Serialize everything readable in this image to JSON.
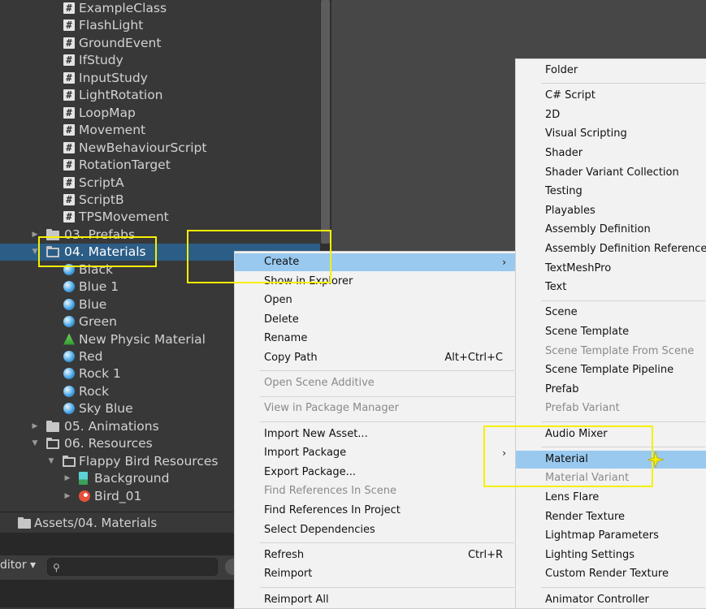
{
  "project": {
    "tree": [
      {
        "indent": 1,
        "icon": "hash",
        "label": "ExampleClass"
      },
      {
        "indent": 1,
        "icon": "hash",
        "label": "FlashLight"
      },
      {
        "indent": 1,
        "icon": "hash",
        "label": "GroundEvent"
      },
      {
        "indent": 1,
        "icon": "hash",
        "label": "IfStudy"
      },
      {
        "indent": 1,
        "icon": "hash",
        "label": "InputStudy"
      },
      {
        "indent": 1,
        "icon": "hash",
        "label": "LightRotation"
      },
      {
        "indent": 1,
        "icon": "hash",
        "label": "LoopMap"
      },
      {
        "indent": 1,
        "icon": "hash",
        "label": "Movement"
      },
      {
        "indent": 1,
        "icon": "hash",
        "label": "NewBehaviourScript"
      },
      {
        "indent": 1,
        "icon": "hash",
        "label": "RotationTarget"
      },
      {
        "indent": 1,
        "icon": "hash",
        "label": "ScriptA"
      },
      {
        "indent": 1,
        "icon": "hash",
        "label": "ScriptB"
      },
      {
        "indent": 1,
        "icon": "hash",
        "label": "TPSMovement"
      },
      {
        "indent": 0,
        "icon": "folder",
        "arrow": "▶",
        "label": "03. Prefabs"
      },
      {
        "indent": 0,
        "icon": "folder-open",
        "arrow": "▼",
        "label": "04. Materials",
        "selected": true
      },
      {
        "indent": 1,
        "icon": "sphere",
        "label": "Black"
      },
      {
        "indent": 1,
        "icon": "sphere",
        "label": "Blue 1"
      },
      {
        "indent": 1,
        "icon": "sphere",
        "label": "Blue"
      },
      {
        "indent": 1,
        "icon": "sphere",
        "label": "Green"
      },
      {
        "indent": 1,
        "icon": "physic",
        "label": "New Physic Material"
      },
      {
        "indent": 1,
        "icon": "sphere",
        "label": "Red"
      },
      {
        "indent": 1,
        "icon": "sphere",
        "label": "Rock 1"
      },
      {
        "indent": 1,
        "icon": "sphere",
        "label": "Rock"
      },
      {
        "indent": 1,
        "icon": "sphere",
        "label": "Sky Blue"
      },
      {
        "indent": 0,
        "icon": "folder",
        "arrow": "▶",
        "label": "05. Animations"
      },
      {
        "indent": 0,
        "icon": "folder-open",
        "arrow": "▼",
        "label": "06. Resources"
      },
      {
        "indent": 1,
        "icon": "folder-open",
        "arrow": "▼",
        "label": "Flappy Bird Resources"
      },
      {
        "indent": 2,
        "icon": "bgsprite",
        "arrow": "▶",
        "label": "Background"
      },
      {
        "indent": 2,
        "icon": "bird",
        "arrow": "▶",
        "label": "Bird_01"
      }
    ],
    "breadcrumb": "Assets/04. Materials"
  },
  "toolbar": {
    "editor_label": "ditor ▾",
    "search_icon": "⚲"
  },
  "context_menu": {
    "items": [
      {
        "label": "Create",
        "submenu": true,
        "highlight": true
      },
      {
        "label": "Show in Explorer"
      },
      {
        "label": "Open"
      },
      {
        "label": "Delete"
      },
      {
        "label": "Rename"
      },
      {
        "label": "Copy Path",
        "shortcut": "Alt+Ctrl+C"
      },
      {
        "sep": true
      },
      {
        "label": "Open Scene Additive",
        "disabled": true
      },
      {
        "sep": true
      },
      {
        "label": "View in Package Manager",
        "disabled": true
      },
      {
        "sep": true
      },
      {
        "label": "Import New Asset..."
      },
      {
        "label": "Import Package",
        "submenu": true
      },
      {
        "label": "Export Package..."
      },
      {
        "label": "Find References In Scene",
        "disabled": true
      },
      {
        "label": "Find References In Project"
      },
      {
        "label": "Select Dependencies"
      },
      {
        "sep": true
      },
      {
        "label": "Refresh",
        "shortcut": "Ctrl+R"
      },
      {
        "label": "Reimport"
      },
      {
        "sep": true
      },
      {
        "label": "Reimport All"
      }
    ]
  },
  "create_menu": {
    "items": [
      {
        "label": "Folder"
      },
      {
        "sep": true
      },
      {
        "label": "C# Script"
      },
      {
        "label": "2D"
      },
      {
        "label": "Visual Scripting"
      },
      {
        "label": "Shader"
      },
      {
        "label": "Shader Variant Collection"
      },
      {
        "label": "Testing"
      },
      {
        "label": "Playables"
      },
      {
        "label": "Assembly Definition"
      },
      {
        "label": "Assembly Definition Reference"
      },
      {
        "label": "TextMeshPro"
      },
      {
        "label": "Text"
      },
      {
        "sep": true
      },
      {
        "label": "Scene"
      },
      {
        "label": "Scene Template"
      },
      {
        "label": "Scene Template From Scene",
        "disabled": true
      },
      {
        "label": "Scene Template Pipeline"
      },
      {
        "label": "Prefab"
      },
      {
        "label": "Prefab Variant",
        "disabled": true
      },
      {
        "sep": true
      },
      {
        "label": "Audio Mixer"
      },
      {
        "sep": true
      },
      {
        "label": "Material",
        "highlight": true
      },
      {
        "label": "Material Variant",
        "disabled": true
      },
      {
        "label": "Lens Flare"
      },
      {
        "label": "Render Texture"
      },
      {
        "label": "Lightmap Parameters"
      },
      {
        "label": "Lighting Settings"
      },
      {
        "label": "Custom Render Texture"
      },
      {
        "sep": true
      },
      {
        "label": "Animator Controller"
      }
    ]
  },
  "colors": {
    "selection": "#2c5d87",
    "menu_highlight": "#99c9ef",
    "annotation": "#f5f000"
  }
}
